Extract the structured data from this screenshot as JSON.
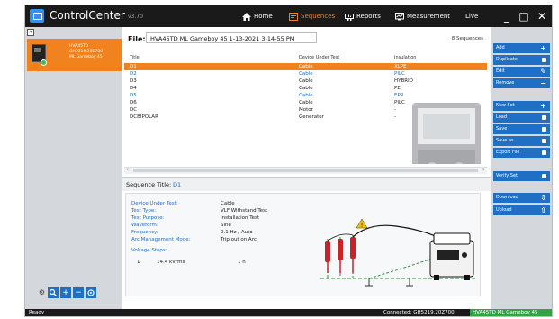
{
  "app": {
    "title": "ControlCenter",
    "version": "v3.70"
  },
  "nav": {
    "home": "Home",
    "sequences": "Sequences",
    "reports": "Reports",
    "measurement": "Measurement",
    "live": "Live"
  },
  "window": {
    "minimize": "_",
    "maximize": "□",
    "close": "✕"
  },
  "device": {
    "line1": "HVA45TD",
    "line2": "GH5219.20Z700",
    "line3": "ML Gameboy 45"
  },
  "file": {
    "label": "File:",
    "name": "HVA45TD ML Gameboy 45 1-13-2021 3-14-55 PM",
    "count": "8 Sequences"
  },
  "table": {
    "headers": [
      "Title",
      "Device Under Test",
      "Insulation"
    ],
    "rows": [
      {
        "title": "D1",
        "device": "Cable",
        "insulation": "XLPE",
        "selected": true
      },
      {
        "title": "D2",
        "device": "Cable",
        "insulation": "PILC",
        "blue": true
      },
      {
        "title": "D3",
        "device": "Cable",
        "insulation": "HYBRID"
      },
      {
        "title": "D4",
        "device": "Cable",
        "insulation": "PE"
      },
      {
        "title": "D5",
        "device": "Cable",
        "insulation": "EPR",
        "blue": true
      },
      {
        "title": "D6",
        "device": "Cable",
        "insulation": "PILC"
      },
      {
        "title": "DC",
        "device": "Motor",
        "insulation": "-"
      },
      {
        "title": "DCBIPOLAR",
        "device": "Generator",
        "insulation": "-"
      }
    ]
  },
  "sequence": {
    "title_label": "Sequence Title:",
    "title_value": "D1",
    "details": [
      {
        "label": "Device Under Test:",
        "value": "Cable"
      },
      {
        "label": "Test Type:",
        "value": "VLF Withstand Test"
      },
      {
        "label": "Test Purpose:",
        "value": "Installation Test"
      },
      {
        "label": "Waveform:",
        "value": "Sine"
      },
      {
        "label": "Frequency:",
        "value": "0.1 Hz / Auto"
      },
      {
        "label": "Arc Management Mode:",
        "value": "Trip out on Arc"
      }
    ],
    "voltage_steps_label": "Voltage Steps:",
    "voltage_steps": [
      {
        "step": "1",
        "voltage": "14.4 kVrms",
        "duration": "1 h"
      }
    ]
  },
  "actions": {
    "add": "Add",
    "duplicate": "Duplicate",
    "edit": "Edit",
    "remove": "Remove",
    "new_set": "New Set",
    "load": "Load",
    "save": "Save",
    "save_as": "Save as",
    "export_file": "Export File",
    "verify_set": "Verify Set",
    "download": "Download",
    "upload": "Upload"
  },
  "status": {
    "ready": "Ready",
    "connected": "Connected: GH5219.20Z700",
    "device": "HVA45TD ML Gameboy 45"
  },
  "colors": {
    "accent": "#f0831f",
    "primary": "#1f6fc4",
    "status_ok": "#35a245",
    "chrome": "#1a1a1a"
  }
}
